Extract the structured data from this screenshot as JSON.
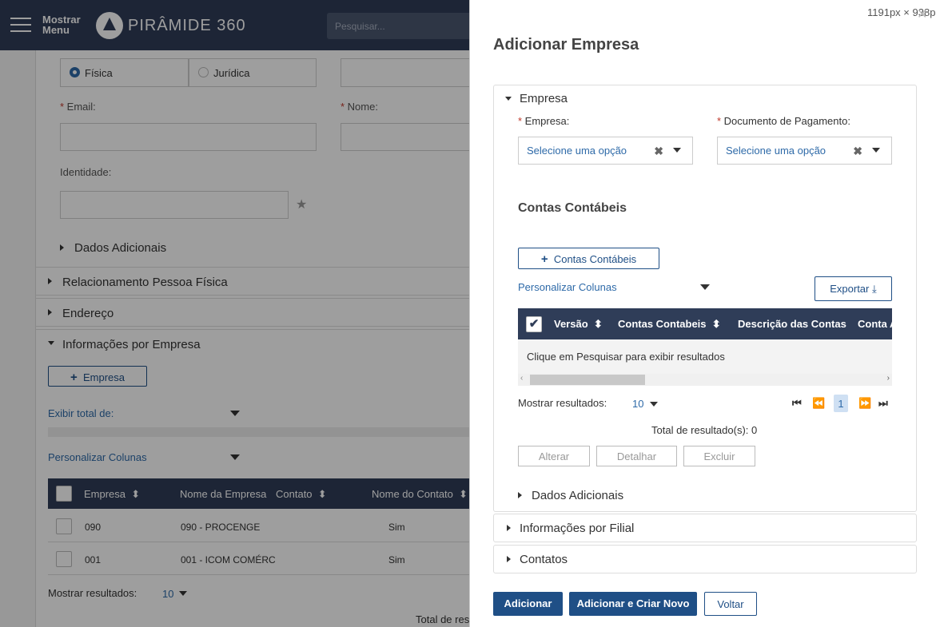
{
  "topbar": {
    "menu_label_1": "Mostrar",
    "menu_label_2": "Menu",
    "brand": "PIRÂMIDE 360",
    "search_placeholder": "Pesquisar..."
  },
  "background": {
    "tipo_fisica": "Física",
    "tipo_juridica": "Jurídica",
    "email_label": "Email:",
    "nome_label": "Nome:",
    "identidade_label": "Identidade:",
    "dados_adicionais": "Dados Adicionais",
    "sections": [
      "Relacionamento Pessoa Física",
      "Endereço",
      "Informações por Empresa"
    ],
    "empresa_button": "Empresa",
    "exibir_total": "Exibir total de:",
    "personalizar_colunas": "Personalizar Colunas",
    "columns": [
      "Empresa",
      "Nome da Empresa",
      "Contato",
      "Nome do Contato"
    ],
    "rows": [
      {
        "empresa": "090",
        "nome": "090 - PROCENGE",
        "contato": "Sim"
      },
      {
        "empresa": "001",
        "nome": "001 - ICOM COMÉRC",
        "contato": "Sim"
      }
    ],
    "mostrar_resultados": "Mostrar resultados:",
    "mostrar_value": "10",
    "total_partial": "Total de res"
  },
  "modal": {
    "size_readout": "1191px × 938p",
    "title": "Adicionar Empresa",
    "panel_empresa": "Empresa",
    "empresa_label": "Empresa:",
    "documento_label": "Documento de Pagamento:",
    "select_placeholder": "Selecione uma opção",
    "contas_title": "Contas Contábeis",
    "contas_button": "Contas Contábeis",
    "personalizar_colunas": "Personalizar Colunas",
    "exportar": "Exportar",
    "columns": [
      "Versão",
      "Contas Contabeis",
      "Descrição das Contas Co",
      "Conta A"
    ],
    "empty_message": "Clique em Pesquisar para exibir resultados",
    "mostrar_resultados": "Mostrar resultados:",
    "mostrar_value": "10",
    "current_page": "1",
    "total": "Total de resultado(s): 0",
    "actions": [
      "Alterar",
      "Detalhar",
      "Excluir"
    ],
    "dados_adicionais": "Dados Adicionais",
    "info_filial": "Informações por Filial",
    "contatos": "Contatos",
    "footer": {
      "adicionar": "Adicionar",
      "adicionar_novo": "Adicionar e Criar Novo",
      "voltar": "Voltar"
    },
    "primary_color": "#1f4f86"
  }
}
